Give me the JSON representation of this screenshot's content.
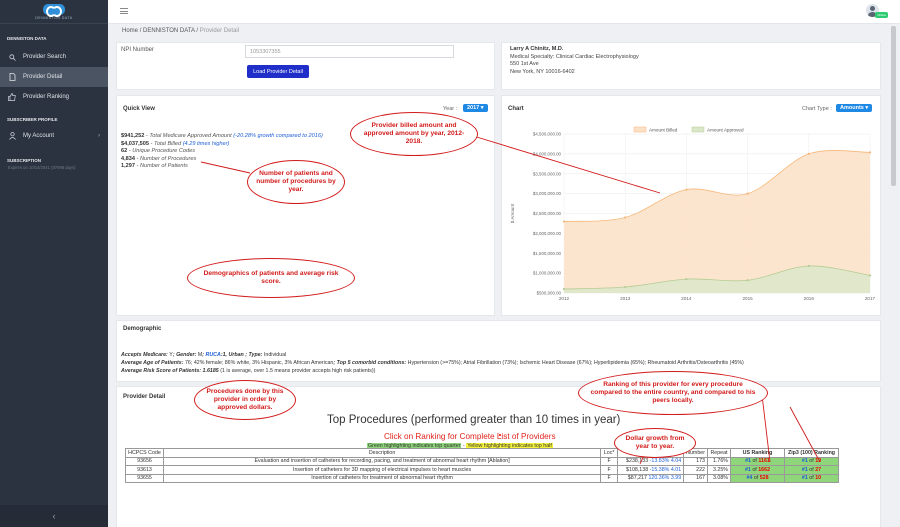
{
  "brand": {
    "logo_text": "DENNISTON DATA"
  },
  "sidebar": {
    "section_data": "DENNISTON DATA",
    "items": [
      {
        "label": "Provider Search",
        "icon": "search-icon"
      },
      {
        "label": "Provider Detail",
        "icon": "file-icon"
      },
      {
        "label": "Provider Ranking",
        "icon": "thumbs-up-icon"
      }
    ],
    "section_profile": "SUBSCRIBER PROFILE",
    "account": {
      "label": "My Account",
      "icon": "user-icon"
    },
    "section_subscription": "SUBSCRIPTION",
    "expires": "Expires on 10/14/2041 (87898 days)",
    "collapse_icon": "chevron-left-icon"
  },
  "topbar": {
    "badge": "Online"
  },
  "breadcrumb": {
    "home": "Home",
    "sep": "/",
    "section": "DENNISTON DATA",
    "current": "Provider Detail"
  },
  "search": {
    "npi_label": "NPI Number",
    "npi_value": "1053307355",
    "load_label": "Load Provider Detail"
  },
  "provider": {
    "name": "Larry A Chinitz, M.D.",
    "specialty": "Medical Specialty: Clinical Cardiac Electrophysiology",
    "address1": "550 1st Ave",
    "address2": "New York, NY 10016-6402"
  },
  "quick_view": {
    "title": "Quick View",
    "year_label": "Year :",
    "year_value": "2017 ▾",
    "approved_amount": "$941,252",
    "approved_label": " - Total Medicare Approved Amount ",
    "approved_growth": "(-20.28% growth compared to 2016)",
    "billed_amount": "$4,037,505",
    "billed_label": " - Total Billed ",
    "billed_ratio": "(4.29 times higher)",
    "codes": "62",
    "codes_label": " - Unique Procedure Codes",
    "procedures": "4,834",
    "procedures_label": " - Number of Procedures",
    "patients": "1,297",
    "patients_label": " - Number of Patients"
  },
  "chart_panel": {
    "title": "Chart",
    "type_label": "Chart Type :",
    "type_value": "Amounts ▾"
  },
  "chart_data": {
    "type": "area",
    "x": [
      2012,
      2013,
      2014,
      2015,
      2016,
      2017
    ],
    "series": [
      {
        "name": "Amount Billed",
        "values": [
          2300000,
          2400000,
          3100000,
          3000000,
          4000000,
          4037505
        ],
        "color": "#fbe1c5",
        "stroke": "#f5b87a"
      },
      {
        "name": "Amount Approved",
        "values": [
          600000,
          650000,
          850000,
          820000,
          1180000,
          941252
        ],
        "color": "#dbe7c9",
        "stroke": "#b5cc93"
      }
    ],
    "ylabel": "$ Amount",
    "ylim": [
      500000,
      4500000
    ],
    "yticks": [
      "$4,500,000.00",
      "$4,000,000.00",
      "$3,500,000.00",
      "$3,000,000.00",
      "$2,500,000.00",
      "$2,000,000.00",
      "$1,500,000.00",
      "$1,000,000.00",
      "$500,000.00"
    ],
    "grid": true,
    "legend": "top-center"
  },
  "demographic": {
    "title": "Demographic",
    "line1_a": "Accepts Medicare: ",
    "line1_b": "Y",
    "line1_c": "; Gender: ",
    "line1_d": "M",
    "line1_e": "; ",
    "line1_f": "RUCA",
    "line1_g": ":1, Urban ; Type: ",
    "line1_h": "Individual",
    "line2_a": "Average Age of Patients: ",
    "line2_b": "76; 42% female; 86% white, 3% Hispanic, 3% African American",
    "line2_c": "; Top 5 comorbid conditions: ",
    "line2_d": "Hypertension (>=75%); Atrial Fibrillation (73%); Ischemic Heart Disease (67%); Hyperlipidemia (65%); Rheumatoid Arthritis/Osteoarthritis (45%)",
    "line3_a": "Average Risk Score of Patients: ",
    "line3_b": "1.6185",
    "line3_c": " (1 is average, over 1.5 means provider accepts high risk patients))"
  },
  "provider_detail": {
    "title": "Provider Detail",
    "proc_title": "Top Procedures (performed greater than 10 times in year)",
    "proc_sub": "Click on Ranking for Complete List of Providers",
    "hl_green": "Green highlighting indicates top quarter",
    "hl_sep": " - ",
    "hl_yellow": "Yellow highlighting indicates top half",
    "columns": [
      "HCPCS Code",
      "Description",
      "Loc*",
      "Dollars",
      "Number",
      "Repeat",
      "US Ranking",
      "Zip3 (100) Ranking"
    ],
    "rows": [
      {
        "code": "93656",
        "desc": "Evaluation and insertion of catheters for recording, pacing, and treatment of abnormal heart rhythm [Ablation]",
        "loc": "F",
        "dollars": "$238,133",
        "pct": "-13.83%",
        "mult": "4.04",
        "number": "173",
        "repeat": "1.76%",
        "us_rank": "#1",
        "us_of": " of ",
        "us_total": "1161",
        "zip_rank": "#1",
        "zip_of": " of ",
        "zip_total": "19"
      },
      {
        "code": "93613",
        "desc": "Insertion of catheters for 3D mapping of electrical impulses to heart muscles",
        "loc": "F",
        "dollars": "$108,138",
        "pct": "-15.38%",
        "mult": "4.01",
        "number": "222",
        "repeat": "3.25%",
        "us_rank": "#1",
        "us_of": " of ",
        "us_total": "1662",
        "zip_rank": "#1",
        "zip_of": " of ",
        "zip_total": "27"
      },
      {
        "code": "93655",
        "desc": "Insertion of catheters for treatment of abnormal heart rhythm",
        "loc": "F",
        "dollars": "$87,217",
        "pct": "120.36%",
        "mult": "3.99",
        "number": "167",
        "repeat": "3.08%",
        "us_rank": "#4",
        "us_of": " of ",
        "us_total": "528",
        "zip_rank": "#1",
        "zip_of": " of ",
        "zip_total": "10"
      }
    ]
  },
  "callouts": {
    "billed": "Provider billed amount and approved amount by year, 2012-2018.",
    "patients": "Number of patients and number of procedures by year.",
    "demographics": "Demographics of patients and average risk score.",
    "procedures": "Procedures done by this provider in order by approved dollars.",
    "ranking": "Ranking of this provider for every procedure compared to the entire country, and compared to his peers locally.",
    "growth": "Dollar growth from year to year."
  }
}
